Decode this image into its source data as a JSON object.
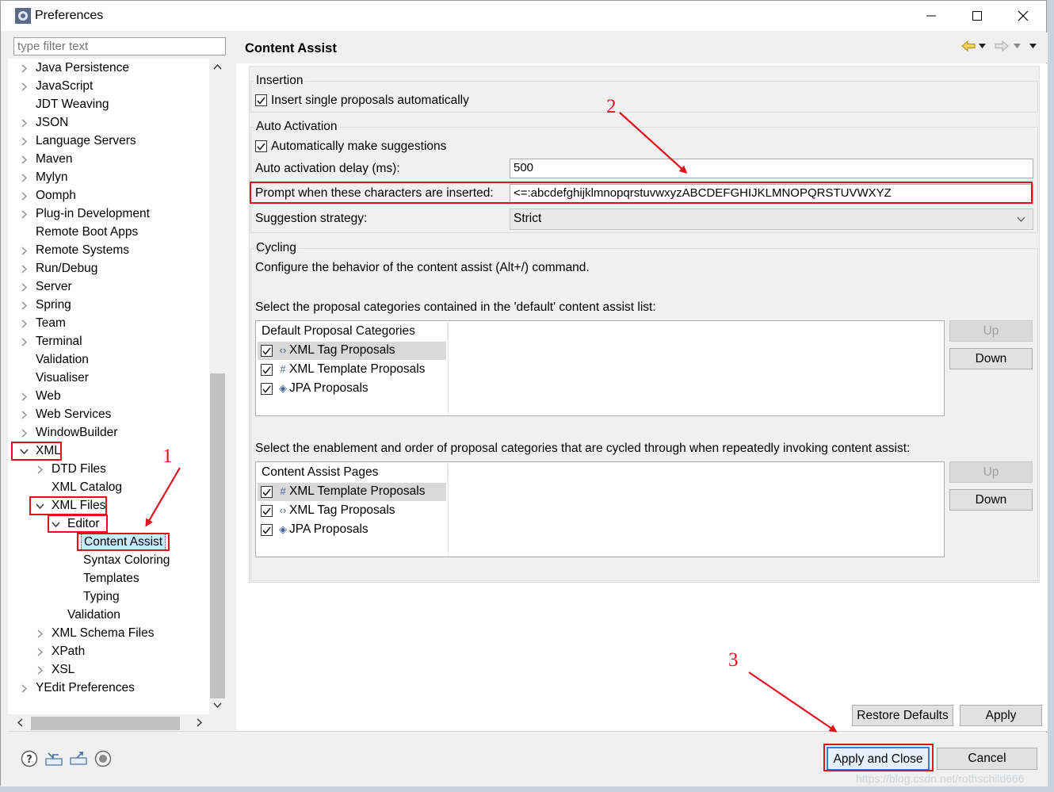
{
  "window": {
    "title": "Preferences"
  },
  "filter": {
    "placeholder": "type filter text"
  },
  "tree": [
    {
      "label": "Java Persistence",
      "level": 0,
      "twisty": "collapsed"
    },
    {
      "label": "JavaScript",
      "level": 0,
      "twisty": "collapsed"
    },
    {
      "label": "JDT Weaving",
      "level": 0,
      "twisty": "none"
    },
    {
      "label": "JSON",
      "level": 0,
      "twisty": "collapsed"
    },
    {
      "label": "Language Servers",
      "level": 0,
      "twisty": "collapsed"
    },
    {
      "label": "Maven",
      "level": 0,
      "twisty": "collapsed"
    },
    {
      "label": "Mylyn",
      "level": 0,
      "twisty": "collapsed"
    },
    {
      "label": "Oomph",
      "level": 0,
      "twisty": "collapsed"
    },
    {
      "label": "Plug-in Development",
      "level": 0,
      "twisty": "collapsed"
    },
    {
      "label": "Remote Boot Apps",
      "level": 0,
      "twisty": "none"
    },
    {
      "label": "Remote Systems",
      "level": 0,
      "twisty": "collapsed"
    },
    {
      "label": "Run/Debug",
      "level": 0,
      "twisty": "collapsed"
    },
    {
      "label": "Server",
      "level": 0,
      "twisty": "collapsed"
    },
    {
      "label": "Spring",
      "level": 0,
      "twisty": "collapsed"
    },
    {
      "label": "Team",
      "level": 0,
      "twisty": "collapsed"
    },
    {
      "label": "Terminal",
      "level": 0,
      "twisty": "collapsed"
    },
    {
      "label": "Validation",
      "level": 0,
      "twisty": "none"
    },
    {
      "label": "Visualiser",
      "level": 0,
      "twisty": "none"
    },
    {
      "label": "Web",
      "level": 0,
      "twisty": "collapsed"
    },
    {
      "label": "Web Services",
      "level": 0,
      "twisty": "collapsed"
    },
    {
      "label": "WindowBuilder",
      "level": 0,
      "twisty": "collapsed"
    },
    {
      "label": "XML",
      "level": 0,
      "twisty": "expanded"
    },
    {
      "label": "DTD Files",
      "level": 1,
      "twisty": "collapsed"
    },
    {
      "label": "XML Catalog",
      "level": 1,
      "twisty": "none"
    },
    {
      "label": "XML Files",
      "level": 1,
      "twisty": "expanded"
    },
    {
      "label": "Editor",
      "level": 2,
      "twisty": "expanded"
    },
    {
      "label": "Content Assist",
      "level": 3,
      "twisty": "none",
      "selected": true
    },
    {
      "label": "Syntax Coloring",
      "level": 3,
      "twisty": "none"
    },
    {
      "label": "Templates",
      "level": 3,
      "twisty": "none"
    },
    {
      "label": "Typing",
      "level": 3,
      "twisty": "none"
    },
    {
      "label": "Validation",
      "level": 2,
      "twisty": "none"
    },
    {
      "label": "XML Schema Files",
      "level": 1,
      "twisty": "collapsed"
    },
    {
      "label": "XPath",
      "level": 1,
      "twisty": "collapsed"
    },
    {
      "label": "XSL",
      "level": 1,
      "twisty": "collapsed"
    },
    {
      "label": "YEdit Preferences",
      "level": 0,
      "twisty": "collapsed"
    }
  ],
  "page": {
    "title": "Content Assist",
    "insertion": {
      "label": "Insertion",
      "single_proposals": "Insert single proposals automatically"
    },
    "auto_activation": {
      "label": "Auto Activation",
      "make_suggestions": "Automatically make suggestions",
      "delay_label": "Auto activation delay (ms):",
      "delay_value": "500",
      "prompt_label": "Prompt when these characters are inserted:",
      "prompt_value": "<=:abcdefghijklmnopqrstuvwxyzABCDEFGHIJKLMNOPQRSTUVWXYZ",
      "strategy_label": "Suggestion strategy:",
      "strategy_value": "Strict"
    },
    "cycling": {
      "label": "Cycling",
      "description": "Configure the behavior of the content assist (Alt+/) command.",
      "default_list_label": "Select the proposal categories contained in the 'default' content assist list:",
      "default_list_header": "Default Proposal Categories",
      "default_items": [
        {
          "label": "XML Tag Proposals",
          "icon": "tag-icon",
          "glyph": "‹›"
        },
        {
          "label": "XML Template Proposals",
          "icon": "template-icon",
          "glyph": "#"
        },
        {
          "label": "JPA Proposals",
          "icon": "jpa-icon",
          "glyph": "◈"
        }
      ],
      "cycled_list_label": "Select the enablement and order of proposal categories that are cycled through when repeatedly invoking content assist:",
      "cycled_list_header": "Content Assist Pages",
      "cycled_items": [
        {
          "label": "XML Template Proposals",
          "icon": "template-icon",
          "glyph": "#"
        },
        {
          "label": "XML Tag Proposals",
          "icon": "tag-icon",
          "glyph": "‹›"
        },
        {
          "label": "JPA Proposals",
          "icon": "jpa-icon",
          "glyph": "◈"
        }
      ],
      "up_label": "Up",
      "down_label": "Down"
    },
    "restore_defaults": "Restore Defaults",
    "apply": "Apply"
  },
  "footer": {
    "apply_close": "Apply and Close",
    "cancel": "Cancel"
  },
  "annotations": [
    "1",
    "2",
    "3"
  ],
  "watermark": "https://blog.csdn.net/rothschild666",
  "accent_color": "#e0101e"
}
